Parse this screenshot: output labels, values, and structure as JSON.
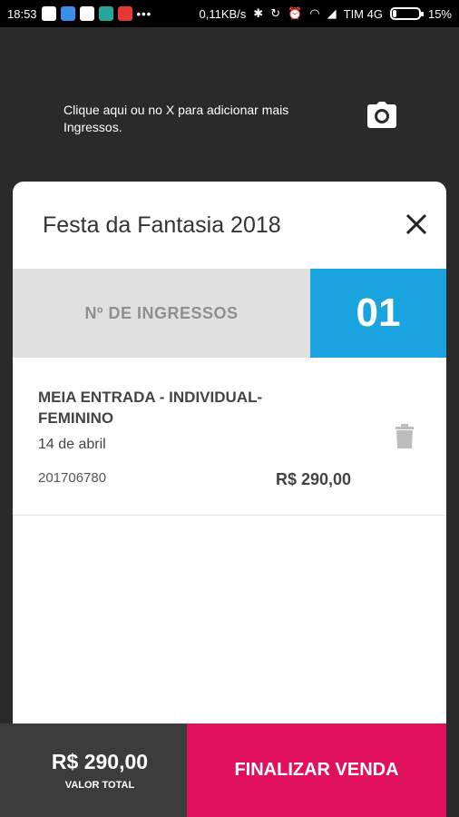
{
  "status_bar": {
    "time": "18:53",
    "network_speed": "0,11KB/s",
    "carrier": "TIM 4G",
    "battery": "15%",
    "battery_level": 0.15
  },
  "hint": {
    "text": "Clique aqui ou no X para adicionar mais Ingressos."
  },
  "card": {
    "title": "Festa da Fantasia 2018",
    "tickets_label": "Nº DE INGRESSOS",
    "tickets_count": "01"
  },
  "item": {
    "name": "MEIA ENTRADA - INDIVIDUAL- FEMININO",
    "date": "14 de abril",
    "code": "201706780",
    "price": "R$ 290,00"
  },
  "footer": {
    "total_value": "R$ 290,00",
    "total_label": "VALOR TOTAL",
    "finalize_label": "FINALIZAR VENDA"
  },
  "colors": {
    "accent_blue": "#1aa4df",
    "accent_pink": "#e0105a",
    "background": "#2a2a2a"
  }
}
